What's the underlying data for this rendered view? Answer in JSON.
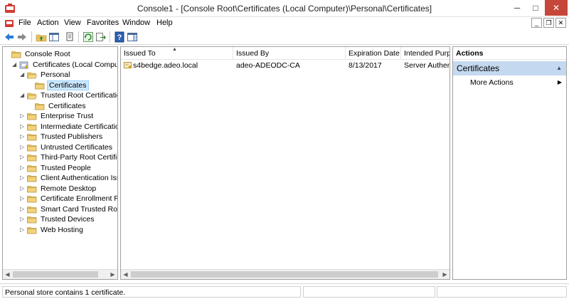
{
  "window": {
    "title": "Console1 - [Console Root\\Certificates (Local Computer)\\Personal\\Certificates]",
    "controls": {
      "minimize": "─",
      "maximize": "□",
      "close": "✕"
    }
  },
  "menubar": {
    "items": [
      "File",
      "Action",
      "View",
      "Favorites",
      "Window",
      "Help"
    ],
    "mdi": {
      "minimize": "_",
      "restore": "❐",
      "close": "✕"
    }
  },
  "toolbar": {
    "buttons": [
      "back-arrow-icon",
      "forward-arrow-icon",
      "up-folder-icon",
      "show-hide-tree-icon",
      "copy-icon",
      "refresh-icon",
      "export-icon",
      "help-icon",
      "show-hide-action-pane-icon"
    ]
  },
  "tree": {
    "items": [
      {
        "label": "Console Root",
        "level": 0,
        "expander": "",
        "icon": "folder"
      },
      {
        "label": "Certificates (Local Computer)",
        "level": 1,
        "expander": "◢",
        "icon": "cert-store"
      },
      {
        "label": "Personal",
        "level": 2,
        "expander": "◢",
        "icon": "folder-open"
      },
      {
        "label": "Certificates",
        "level": 3,
        "expander": "",
        "icon": "folder",
        "selected": true
      },
      {
        "label": "Trusted Root Certification",
        "level": 2,
        "expander": "◢",
        "icon": "folder-open"
      },
      {
        "label": "Certificates",
        "level": 3,
        "expander": "",
        "icon": "folder"
      },
      {
        "label": "Enterprise Trust",
        "level": 2,
        "expander": "▷",
        "icon": "folder"
      },
      {
        "label": "Intermediate Certification A",
        "level": 2,
        "expander": "▷",
        "icon": "folder"
      },
      {
        "label": "Trusted Publishers",
        "level": 2,
        "expander": "▷",
        "icon": "folder"
      },
      {
        "label": "Untrusted Certificates",
        "level": 2,
        "expander": "▷",
        "icon": "folder"
      },
      {
        "label": "Third-Party Root Certificat",
        "level": 2,
        "expander": "▷",
        "icon": "folder"
      },
      {
        "label": "Trusted People",
        "level": 2,
        "expander": "▷",
        "icon": "folder"
      },
      {
        "label": "Client Authentication Issue",
        "level": 2,
        "expander": "▷",
        "icon": "folder"
      },
      {
        "label": "Remote Desktop",
        "level": 2,
        "expander": "▷",
        "icon": "folder"
      },
      {
        "label": "Certificate Enrollment Requ",
        "level": 2,
        "expander": "▷",
        "icon": "folder"
      },
      {
        "label": "Smart Card Trusted Roots",
        "level": 2,
        "expander": "▷",
        "icon": "folder"
      },
      {
        "label": "Trusted Devices",
        "level": 2,
        "expander": "▷",
        "icon": "folder"
      },
      {
        "label": "Web Hosting",
        "level": 2,
        "expander": "▷",
        "icon": "folder"
      }
    ],
    "scroll": {
      "left": "◀",
      "right": "▶"
    }
  },
  "list": {
    "columns": [
      "Issued To",
      "Issued By",
      "Expiration Date",
      "Intended Purpo"
    ],
    "sort_indicator": "▲",
    "rows": [
      {
        "issued_to": "s4bedge.adeo.local",
        "issued_by": "adeo-ADEODC-CA",
        "expiration": "8/13/2017",
        "purpose": "Server Authenti"
      }
    ],
    "scroll": {
      "left": "◀",
      "right": "▶"
    }
  },
  "actions": {
    "header": "Actions",
    "section": "Certificates",
    "collapse": "▲",
    "items": [
      {
        "label": "More Actions",
        "arrow": "▶"
      }
    ]
  },
  "status": {
    "text": "Personal store contains 1 certificate."
  },
  "colors": {
    "selection": "#cce8ff",
    "actions_section": "#c4d9ef",
    "close_button": "#c7463a",
    "folder": "#e8c260"
  }
}
